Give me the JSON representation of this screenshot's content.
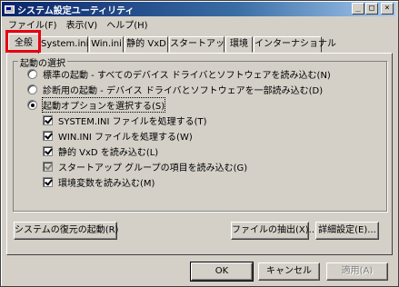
{
  "window": {
    "title": "システム設定ユーティリティ",
    "buttons": {
      "minimize": "_",
      "maximize": "□",
      "close": "×"
    }
  },
  "menu": [
    {
      "label": "ファイル(F)"
    },
    {
      "label": "表示(V)"
    },
    {
      "label": "ヘルプ(H)"
    }
  ],
  "tabs": [
    {
      "label": "全般",
      "active": true
    },
    {
      "label": "System.ini"
    },
    {
      "label": "Win.ini"
    },
    {
      "label": "静的 VxD"
    },
    {
      "label": "スタートアップ"
    },
    {
      "label": "環境"
    },
    {
      "label": "インターナショナル"
    }
  ],
  "startup": {
    "legend": "起動の選択",
    "radios": [
      {
        "label": "標準の起動 - すべてのデバイス ドライバとソフトウェアを読み込む(N)",
        "selected": false
      },
      {
        "label": "診断用の起動 - デバイス ドライバとソフトウェアを一部読み込む(D)",
        "selected": false
      },
      {
        "label": "起動オプションを選択する(S)",
        "selected": true
      }
    ],
    "checks": [
      {
        "label": "SYSTEM.INI ファイルを処理する(T)",
        "checked": true,
        "grayed": false
      },
      {
        "label": "WIN.INI ファイルを処理する(W)",
        "checked": true,
        "grayed": false
      },
      {
        "label": "静的 VxD を読み込む(L)",
        "checked": true,
        "grayed": false
      },
      {
        "label": "スタートアップ グループの項目を読み込む(G)",
        "checked": true,
        "grayed": true
      },
      {
        "label": "環境変数を読み込む(M)",
        "checked": true,
        "grayed": false
      }
    ]
  },
  "actions": {
    "restore": "システムの復元の起動(R)",
    "extract": "ファイルの抽出(X)...",
    "advanced": "詳細設定(E)..."
  },
  "dialog": {
    "ok": "OK",
    "cancel": "キャンセル",
    "apply": "適用(A)"
  }
}
